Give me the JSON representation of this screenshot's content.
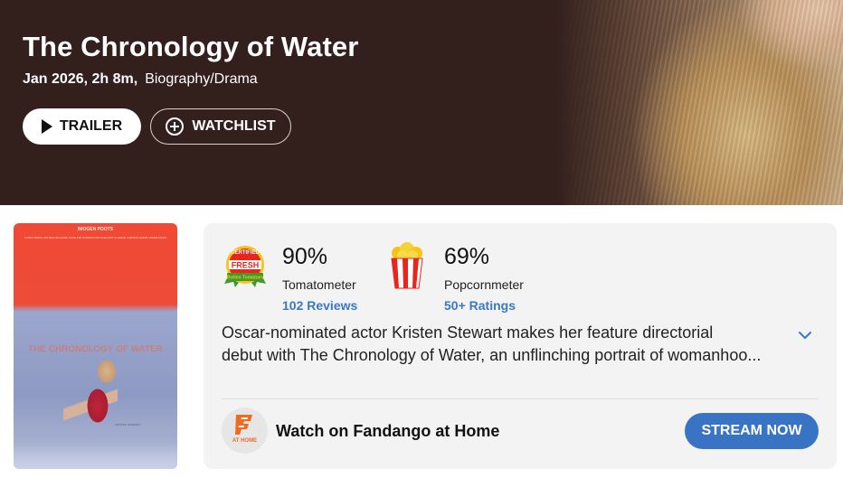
{
  "hero": {
    "title": "The Chronology of Water",
    "meta_date_runtime": "Jan 2026, 2h 8m,",
    "meta_genre": "Biography/Drama",
    "trailer_label": "TRAILER",
    "watchlist_label": "WATCHLIST"
  },
  "poster": {
    "top_name": "IMOGEN POOTS",
    "cast_line": "THORA BIRCH  JIM BELUSHI  EARL CAVE  KIM GORDON  MICHAEL EPP  CHARLIE CARRICK  ESME CREED-MILES",
    "title": "THE CHRONOLOGY OF WATER",
    "credit": "KRISTEN STEWART"
  },
  "scores": {
    "tomatometer": {
      "value": "90%",
      "label": "Tomatometer",
      "count": "102 Reviews",
      "badge_top": "CERTIFIED",
      "badge_main": "FRESH",
      "badge_bottom": "Rotten Tomatoes"
    },
    "popcornmeter": {
      "value": "69%",
      "label": "Popcornmeter",
      "count": "50+ Ratings"
    }
  },
  "synopsis": {
    "line1": "Oscar-nominated actor Kristen Stewart makes her feature directorial",
    "line2": "debut with The Chronology of Water, an unflinching portrait of womanhoo..."
  },
  "stream": {
    "icon_caption": "AT HOME",
    "label": "Watch on Fandango at Home",
    "button_label": "STREAM NOW"
  },
  "colors": {
    "hero_bg": "#33201d",
    "link_blue": "#3a78c2",
    "stream_button": "#3874c3",
    "card_bg": "#f3f3f3",
    "tomato_red": "#e9251c",
    "fresh_green": "#3f9b2f",
    "fandango_orange": "#f06a1f"
  },
  "icons": {
    "trailer": "play-icon",
    "watchlist": "plus-circle-icon",
    "tomatometer": "certified-fresh-icon",
    "popcornmeter": "popcorn-bucket-icon",
    "expand": "chevron-down-icon",
    "fandango": "fandango-at-home-icon"
  }
}
